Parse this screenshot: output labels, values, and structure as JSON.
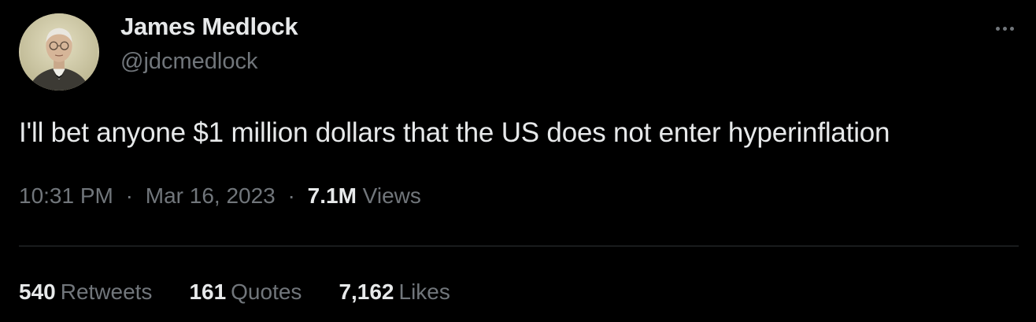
{
  "author": {
    "display_name": "James Medlock",
    "handle": "@jdcmedlock"
  },
  "menu_icon": "more-horizontal-icon",
  "tweet": {
    "text": "I'll bet anyone $1 million dollars that the US does not enter hyperinflation",
    "time": "10:31 PM",
    "separator": "·",
    "date": "Mar 16, 2023",
    "views_count": "7.1M",
    "views_label": "Views"
  },
  "stats": {
    "retweets_count": "540",
    "retweets_label": "Retweets",
    "quotes_count": "161",
    "quotes_label": "Quotes",
    "likes_count": "7,162",
    "likes_label": "Likes"
  },
  "colors": {
    "background": "#000000",
    "primary_text": "#e7e9ea",
    "secondary_text": "#71767b",
    "divider": "#2f3336"
  }
}
